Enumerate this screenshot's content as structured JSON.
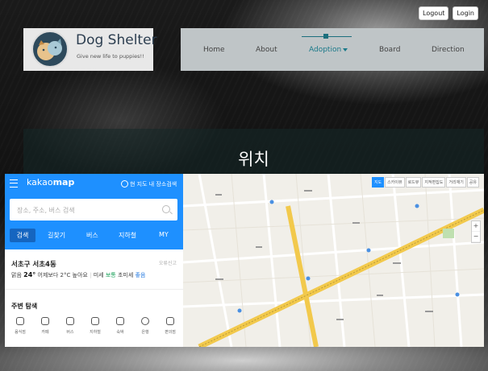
{
  "auth": {
    "logout": "Logout",
    "login": "Login"
  },
  "brand": {
    "name": "Dog Shelter",
    "slogan": "Give new life to puppies!!"
  },
  "nav": {
    "items": [
      "Home",
      "About",
      "Adoption",
      "Board",
      "Direction"
    ],
    "active": "Adoption"
  },
  "hero": {
    "title": "위치"
  },
  "kakaomap": {
    "logo_light": "kakao",
    "logo_bold": "map",
    "current_area_search": "현 지도 내 장소검색",
    "search_placeholder": "장소, 주소, 버스 검색",
    "tabs": [
      "검색",
      "길찾기",
      "버스",
      "지하철",
      "MY"
    ],
    "address": "서초구 서초4동",
    "report": "오류신고",
    "weather": {
      "condition": "맑음",
      "temp": "24°",
      "compare": "어제보다 2°C 높아요",
      "fine_dust_label": "미세",
      "fine_dust": "보통",
      "ultra_fine_label": "초미세",
      "ultra_fine": "좋음"
    },
    "nearby_title": "주변 탐색",
    "categories": [
      "음식점",
      "카페",
      "버스",
      "지하철",
      "숙박",
      "은행",
      "편의점"
    ],
    "map_controls": [
      "지도",
      "스카이뷰",
      "로드뷰",
      "지적편집도",
      "거리재기",
      "공유"
    ]
  },
  "colors": {
    "accent": "#1b7a8a",
    "kakao_blue": "#1e90ff",
    "nav_bg": "#bfc5c7",
    "logo_bg": "#e8e8e8"
  }
}
